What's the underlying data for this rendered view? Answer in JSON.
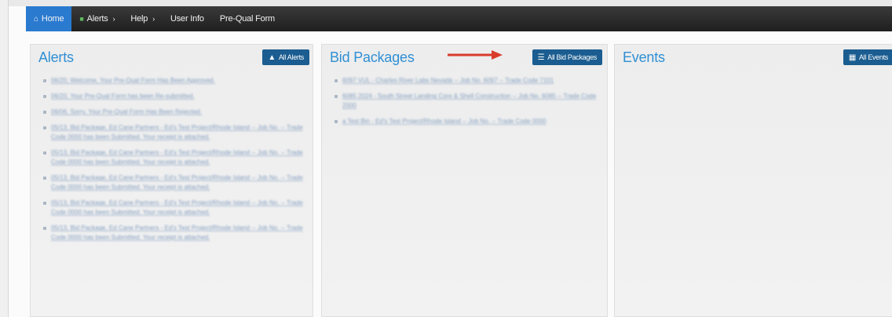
{
  "nav": {
    "items": [
      {
        "label": "Home",
        "icon": "home-icon"
      },
      {
        "label": "Alerts",
        "icon": "alert-icon",
        "caret": "›"
      },
      {
        "label": "Help",
        "caret": "›"
      },
      {
        "label": "User Info"
      },
      {
        "label": "Pre-Qual Form"
      }
    ]
  },
  "panels": {
    "alerts": {
      "title": "Alerts",
      "button_label": "All Alerts",
      "button_icon": "warning-icon",
      "items": [
        "06/20, Welcome, Your Pre-Qual Form Has Been Approved.",
        "06/20, Your Pre-Qual Form has been Re-submitted.",
        "06/06, Sorry, Your Pre-Qual Form Has Been Rejected.",
        "05/13, Bid Package, Ed Cane Partners - Ed's Test Project/Rhode Island -- Job No. -- Trade Code 0000 has been Submitted. Your receipt is attached.",
        "05/13, Bid Package, Ed Cane Partners - Ed's Test Project/Rhode Island -- Job No. -- Trade Code 0000 has been Submitted. Your receipt is attached.",
        "05/13, Bid Package, Ed Cane Partners - Ed's Test Project/Rhode Island -- Job No. -- Trade Code 0000 has been Submitted. Your receipt is attached.",
        "05/13, Bid Package, Ed Cane Partners - Ed's Test Project/Rhode Island -- Job No. -- Trade Code 0000 has been Submitted. Your receipt is attached.",
        "05/13, Bid Package, Ed Cane Partners - Ed's Test Project/Rhode Island -- Job No. -- Trade Code 0000 has been Submitted. Your receipt is attached."
      ]
    },
    "bids": {
      "title": "Bid Packages",
      "button_label": "All Bid Packages",
      "button_icon": "list-icon",
      "items": [
        "6097 VUL - Charles River Labs Nevada -- Job No. 6097 -- Trade Code 7101",
        "6085 2024 - South Street Landing Core & Shell Construction -- Job No. 6085 -- Trade Code 2000",
        "a Test Bin - Ed's Test Project/Rhode Island -- Job No. -- Trade Code 0000"
      ]
    },
    "events": {
      "title": "Events",
      "button_label": "All Events",
      "button_icon": "calendar-icon"
    }
  },
  "colors": {
    "navbar": "#2a2a2a",
    "nav_active": "#2a7ad0",
    "panel_title": "#2f8fd4",
    "button": "#1b5d90",
    "arrow": "#d93b2b"
  }
}
